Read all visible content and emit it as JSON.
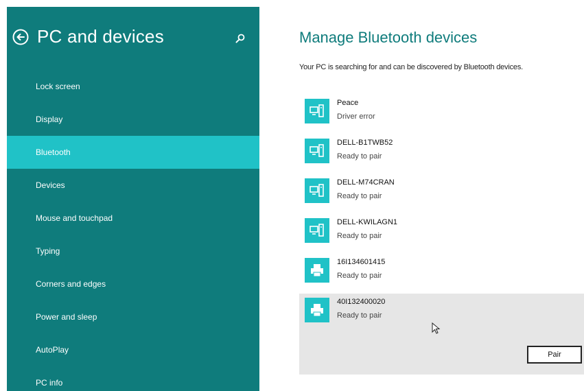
{
  "sidebar": {
    "title": "PC and devices",
    "back_icon": "back-arrow-circle-icon",
    "search_icon": "search-icon",
    "items": [
      {
        "label": "Lock screen",
        "selected": false
      },
      {
        "label": "Display",
        "selected": false
      },
      {
        "label": "Bluetooth",
        "selected": true
      },
      {
        "label": "Devices",
        "selected": false
      },
      {
        "label": "Mouse and touchpad",
        "selected": false
      },
      {
        "label": "Typing",
        "selected": false
      },
      {
        "label": "Corners and edges",
        "selected": false
      },
      {
        "label": "Power and sleep",
        "selected": false
      },
      {
        "label": "AutoPlay",
        "selected": false
      },
      {
        "label": "PC info",
        "selected": false
      }
    ]
  },
  "main": {
    "title": "Manage Bluetooth devices",
    "description": "Your PC is searching for and can be discovered by Bluetooth devices.",
    "devices": [
      {
        "name": "Peace",
        "status": "Driver error",
        "icon": "computer-icon"
      },
      {
        "name": "DELL-B1TWB52",
        "status": "Ready to pair",
        "icon": "computer-icon"
      },
      {
        "name": "DELL-M74CRAN",
        "status": "Ready to pair",
        "icon": "computer-icon"
      },
      {
        "name": "DELL-KWILAGN1",
        "status": "Ready to pair",
        "icon": "computer-icon"
      },
      {
        "name": "16I134601415",
        "status": "Ready to pair",
        "icon": "printer-icon"
      },
      {
        "name": "40I132400020",
        "status": "Ready to pair",
        "icon": "printer-icon"
      }
    ],
    "pair_button_label": "Pair"
  },
  "colors": {
    "sidebar_bg": "#0f7c7c",
    "accent": "#20c2c7",
    "selected_row_bg": "#e6e6e6"
  }
}
